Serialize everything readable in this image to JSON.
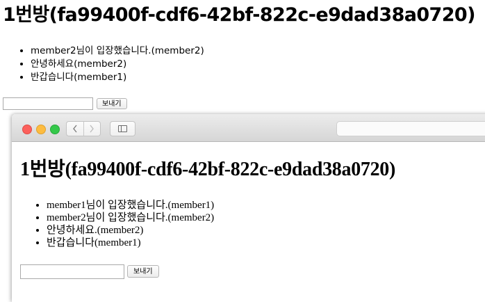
{
  "outer": {
    "title": "1번방(fa99400f-cdf6-42bf-822c-e9dad38a0720)",
    "messages": [
      "member2님이 입장했습니다.(member2)",
      "안녕하세요(member2)",
      "반갑습니다(member1)"
    ],
    "input_value": "",
    "send_label": "보내기"
  },
  "browser": {
    "back_icon": "chevron-left-icon",
    "forward_icon": "chevron-right-icon",
    "sidebar_icon": "sidebar-icon",
    "address": "",
    "title": "1번방(fa99400f-cdf6-42bf-822c-e9dad38a0720)",
    "messages": [
      "member1님이 입장했습니다.(member1)",
      "member2님이 입장했습니다.(member2)",
      "안녕하세요.(member2)",
      "반갑습니다(member1)"
    ],
    "input_value": "",
    "send_label": "보내기"
  },
  "colors": {
    "close": "#fc605c",
    "minimize": "#fdbc40",
    "zoom": "#34c84a"
  }
}
